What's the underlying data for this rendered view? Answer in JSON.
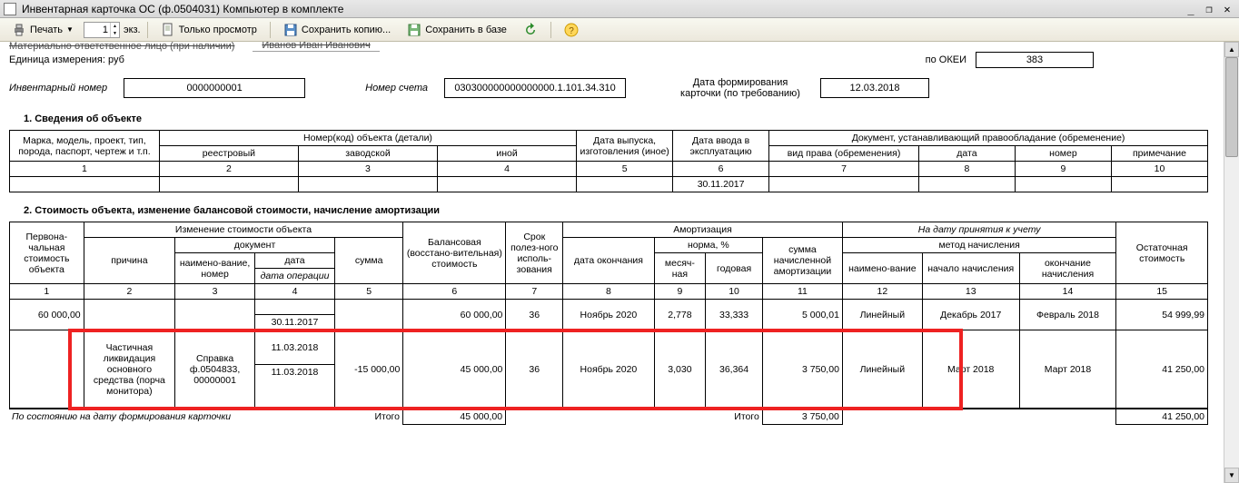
{
  "window": {
    "title": "Инвентарная карточка ОС (ф.0504031) Компьютер в комплекте"
  },
  "toolbar": {
    "print": "Печать",
    "copies_value": "1",
    "copies_unit": "экз.",
    "view_only": "Только просмотр",
    "save_copy": "Сохранить копию...",
    "save_db": "Сохранить в базе"
  },
  "top": {
    "resp_label": "Материально ответственное лицо (при наличии)",
    "resp_value": "Иванов Иван Иванович",
    "unit_label": "Единица измерения: руб",
    "okei_label": "по ОКЕИ",
    "okei_value": "383"
  },
  "header": {
    "inv_no_label": "Инвентарный номер",
    "inv_no": "0000000001",
    "acct_label": "Номер счета",
    "acct": "030300000000000000.1.101.34.310",
    "date_label": "Дата формирования карточки (по требованию)",
    "date": "12.03.2018"
  },
  "section1_title": "1. Сведения об объекте",
  "t1": {
    "h1": "Марка, модель, проект, тип, порода, паспорт, чертеж и т.п.",
    "h2": "Номер(код) объекта (детали)",
    "h2a": "реестровый",
    "h2b": "заводской",
    "h2c": "иной",
    "h3": "Дата выпуска, изготовления (иное)",
    "h4": "Дата ввода в эксплуатацию",
    "h5": "Документ, устанавливающий правообладание (обременение)",
    "h5a": "вид права (обременения)",
    "h5b": "дата",
    "h5c": "номер",
    "h5d": "примечание",
    "cols": [
      "1",
      "2",
      "3",
      "4",
      "5",
      "6",
      "7",
      "8",
      "9",
      "10"
    ],
    "row_date": "30.11.2017"
  },
  "section2_title": "2. Стоимость объекта, изменение балансовой стоимости, начисление амортизации",
  "t2": {
    "h_initial": "Первона-чальная стоимость объекта",
    "h_change": "Изменение стоимости объекта",
    "h_reason": "причина",
    "h_doc": "документ",
    "h_doc_name": "наимено-вание, номер",
    "h_doc_date": "дата",
    "h_doc_date2": "дата операции",
    "h_sum": "сумма",
    "h_balance": "Балансовая (восстано-вительная) стоимость",
    "h_life": "Срок полез-ного исполь-зования",
    "h_amort": "Амортизация",
    "h_amort_note": "На дату принятия к учету",
    "h_end_date": "дата окончания",
    "h_norm": "норма, %",
    "h_norm_m": "месяч-ная",
    "h_norm_y": "годовая",
    "h_accrued": "сумма начисленной амортизации",
    "h_method": "метод начисления",
    "h_method_name": "наимено-вание",
    "h_method_start": "начало начисления",
    "h_method_end": "окончание начисления",
    "h_residual": "Остаточная стоимость",
    "cols": [
      "1",
      "2",
      "3",
      "4",
      "5",
      "6",
      "7",
      "8",
      "9",
      "10",
      "11",
      "12",
      "13",
      "14",
      "15"
    ],
    "r1": {
      "c1": "60 000,00",
      "c4_date": "30.11.2017",
      "c6": "60 000,00",
      "c7": "36",
      "c8": "Ноябрь 2020",
      "c9": "2,778",
      "c10": "33,333",
      "c11": "5 000,01",
      "c12": "Линейный",
      "c13": "Декабрь 2017",
      "c14": "Февраль 2018",
      "c15": "54 999,99"
    },
    "r2": {
      "c2": "Частичная ликвидация основного средства (порча монитора)",
      "c3": "Справка ф.0504833, 00000001",
      "c4a": "11.03.2018",
      "c4b": "11.03.2018",
      "c5": "-15 000,00",
      "c6": "45 000,00",
      "c7": "36",
      "c8": "Ноябрь 2020",
      "c9": "3,030",
      "c10": "36,364",
      "c11": "3 750,00",
      "c12": "Линейный",
      "c13": "Март 2018",
      "c14": "Март 2018",
      "c15": "41 250,00"
    },
    "totals_label": "По состоянию на дату формирования карточки",
    "totals_word": "Итого",
    "totals_balance": "45 000,00",
    "totals_accrued": "3 750,00",
    "totals_residual": "41 250,00"
  }
}
